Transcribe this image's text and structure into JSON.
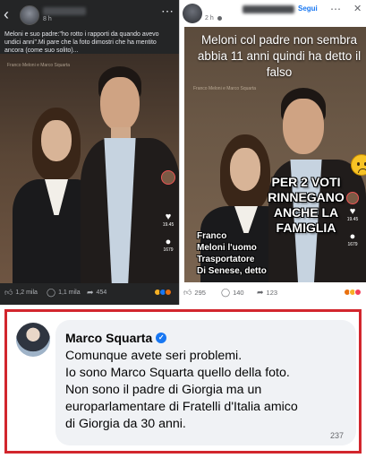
{
  "left_post": {
    "time": "8 h",
    "more_icon": "more-horizontal-icon",
    "caption": "Meloni e suo padre:\"ho rotto i rapporti da quando avevo undici anni\".Mi pare che la foto dimostri che ha mentito ancora (come suo solito)...",
    "watermark": "Franco Meloni e Marco Squarta",
    "reel_counts": [
      "19.45",
      "1679"
    ],
    "likes": "1,2 mila",
    "comments": "1,1 mila",
    "shares": "454"
  },
  "right_post": {
    "time": "2 h",
    "follow_label": "Segui",
    "top_text": "Meloni col padre non sembra abbia 11 anni quindi ha detto il falso",
    "banner_right": [
      "PER 2 VOTI",
      "RINNEGANO",
      "ANCHE LA",
      "FAMIGLIA"
    ],
    "banner_left": [
      "Franco",
      "Meloni l'uomo",
      "Trasportatore",
      "Di Senese, detto"
    ],
    "watermark": "Franco Meloni e Marco Squarta",
    "reel_counts": [
      "19.45",
      "1679"
    ],
    "likes": "295",
    "comments": "140",
    "shares": "123"
  },
  "comment": {
    "author": "Marco Squarta",
    "verified_icon": "verified-badge-icon",
    "lines": [
      "Comunque avete seri problemi.",
      "Io sono Marco Squarta quello della foto.",
      "Non sono il padre di Giorgia ma un",
      "europarlamentare di Fratelli d'Italia amico",
      "di Giorgia da 30 anni."
    ],
    "reaction_count": "237"
  },
  "colors": {
    "dark_bg": "#242526",
    "highlight_border": "#d2262d",
    "facebook_blue": "#1877f2",
    "bubble_bg": "#f0f2f5"
  }
}
